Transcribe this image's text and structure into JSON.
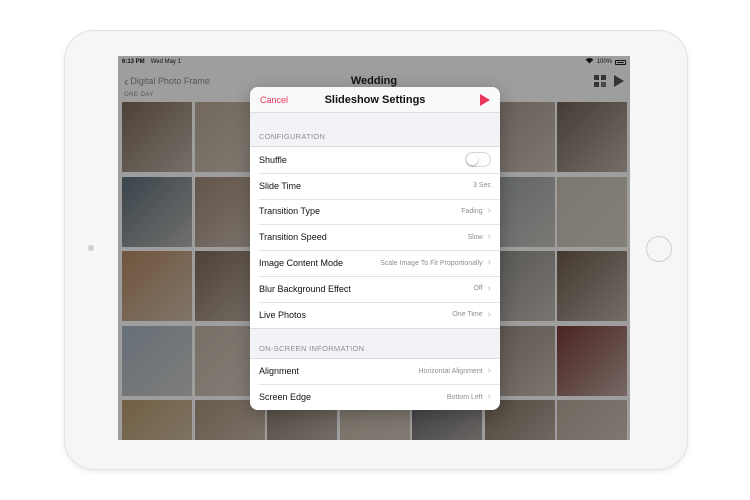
{
  "status_bar": {
    "time": "6:13 PM",
    "date": "Wed May 1",
    "wifi_icon": "wifi-icon",
    "battery": "100%"
  },
  "nav": {
    "back_label": "Digital Photo Frame",
    "title": "Wedding",
    "section_label": "ONE DAY"
  },
  "modal": {
    "cancel_label": "Cancel",
    "title": "Slideshow Settings",
    "accent_color": "#e8375a",
    "configuration": {
      "header": "CONFIGURATION",
      "rows": [
        {
          "label": "Shuffle",
          "type": "toggle",
          "on": false
        },
        {
          "label": "Slide Time",
          "value": "3 Sec"
        },
        {
          "label": "Transition Type",
          "value": "Fading"
        },
        {
          "label": "Transition Speed",
          "value": "Slow"
        },
        {
          "label": "Image Content Mode",
          "value": "Scale Image To Fit Proportionally"
        },
        {
          "label": "Blur Background Effect",
          "value": "Off"
        },
        {
          "label": "Live Photos",
          "value": "One Time"
        }
      ]
    },
    "on_screen": {
      "header": "ON-SCREEN INFORMATION",
      "rows": [
        {
          "label": "Alignment",
          "value": "Horizontal Alignment"
        },
        {
          "label": "Screen Edge",
          "value": "Bottom Left"
        }
      ]
    }
  },
  "thumbnail_colors": [
    "#7d6a5a",
    "#b9a996",
    "#8f7c6a",
    "#9c8f84",
    "#c7b8a6",
    "#a4958a",
    "#6f6256",
    "#5f6f7a",
    "#a08a78",
    "#8a7a6a",
    "#b6a899",
    "#cbbcae",
    "#9aa0a4",
    "#c9c0b6",
    "#b58a62",
    "#7f6a58",
    "#8e8076",
    "#bfb3a4",
    "#a89a8c",
    "#8c8a86",
    "#6d5c4e",
    "#a7b4c2",
    "#c2b5a6",
    "#9a8b7c",
    "#b0a294",
    "#7b7065",
    "#95887c",
    "#7a3b38",
    "#b89a6c",
    "#a9937d",
    "#8f8173",
    "#c4b7a8",
    "#6c6a6e",
    "#847565",
    "#b7a99b"
  ]
}
